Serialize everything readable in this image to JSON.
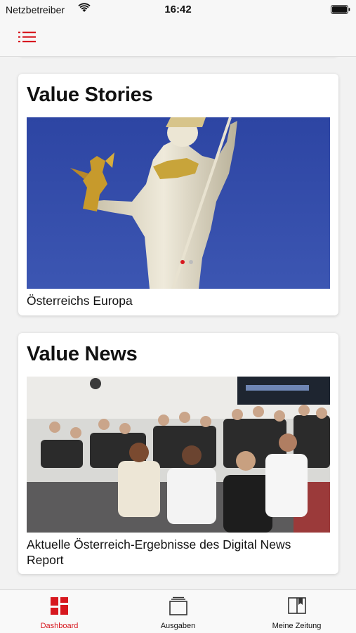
{
  "status_bar": {
    "carrier": "Netzbetreiber",
    "time": "16:42",
    "icons": [
      "wifi-icon",
      "battery-icon"
    ]
  },
  "nav": {
    "menu_icon": "list-menu-icon"
  },
  "cards": [
    {
      "title": "Value Stories",
      "image": "statue-photo",
      "caption": "Österreichs Europa"
    },
    {
      "title": "Value News",
      "image": "conference-audience-photo",
      "caption": "Aktuelle Österreich-Ergebnisse des Digital News Report"
    }
  ],
  "tab_bar": {
    "tabs": [
      {
        "label": "Dashboard",
        "icon": "dashboard-icon",
        "active": true
      },
      {
        "label": "Ausgaben",
        "icon": "editions-icon",
        "active": false
      },
      {
        "label": "Meine Zeitung",
        "icon": "bookmark-book-icon",
        "active": false
      }
    ]
  },
  "colors": {
    "accent": "#d7181f",
    "background": "#f2f2f2",
    "card": "#ffffff"
  }
}
